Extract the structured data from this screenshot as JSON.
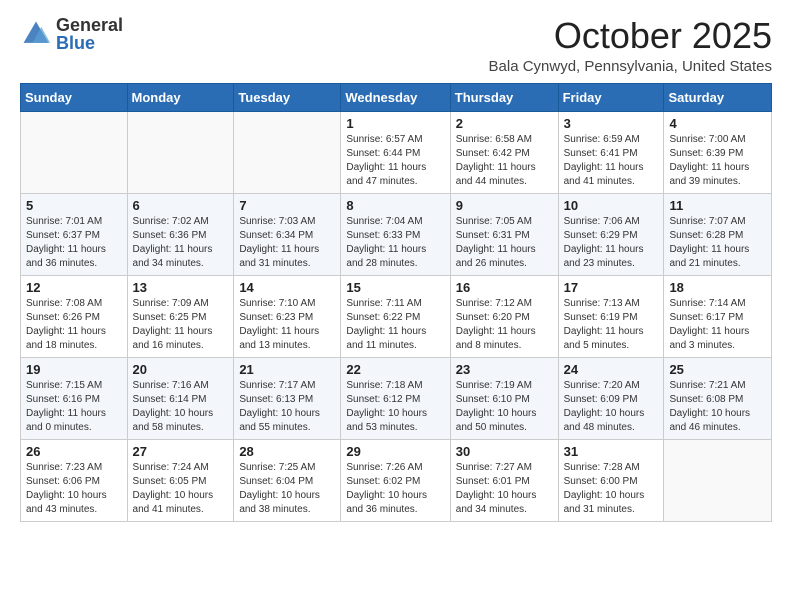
{
  "logo": {
    "general": "General",
    "blue": "Blue"
  },
  "header": {
    "title": "October 2025",
    "location": "Bala Cynwyd, Pennsylvania, United States"
  },
  "days_of_week": [
    "Sunday",
    "Monday",
    "Tuesday",
    "Wednesday",
    "Thursday",
    "Friday",
    "Saturday"
  ],
  "weeks": [
    [
      {
        "day": "",
        "info": ""
      },
      {
        "day": "",
        "info": ""
      },
      {
        "day": "",
        "info": ""
      },
      {
        "day": "1",
        "info": "Sunrise: 6:57 AM\nSunset: 6:44 PM\nDaylight: 11 hours\nand 47 minutes."
      },
      {
        "day": "2",
        "info": "Sunrise: 6:58 AM\nSunset: 6:42 PM\nDaylight: 11 hours\nand 44 minutes."
      },
      {
        "day": "3",
        "info": "Sunrise: 6:59 AM\nSunset: 6:41 PM\nDaylight: 11 hours\nand 41 minutes."
      },
      {
        "day": "4",
        "info": "Sunrise: 7:00 AM\nSunset: 6:39 PM\nDaylight: 11 hours\nand 39 minutes."
      }
    ],
    [
      {
        "day": "5",
        "info": "Sunrise: 7:01 AM\nSunset: 6:37 PM\nDaylight: 11 hours\nand 36 minutes."
      },
      {
        "day": "6",
        "info": "Sunrise: 7:02 AM\nSunset: 6:36 PM\nDaylight: 11 hours\nand 34 minutes."
      },
      {
        "day": "7",
        "info": "Sunrise: 7:03 AM\nSunset: 6:34 PM\nDaylight: 11 hours\nand 31 minutes."
      },
      {
        "day": "8",
        "info": "Sunrise: 7:04 AM\nSunset: 6:33 PM\nDaylight: 11 hours\nand 28 minutes."
      },
      {
        "day": "9",
        "info": "Sunrise: 7:05 AM\nSunset: 6:31 PM\nDaylight: 11 hours\nand 26 minutes."
      },
      {
        "day": "10",
        "info": "Sunrise: 7:06 AM\nSunset: 6:29 PM\nDaylight: 11 hours\nand 23 minutes."
      },
      {
        "day": "11",
        "info": "Sunrise: 7:07 AM\nSunset: 6:28 PM\nDaylight: 11 hours\nand 21 minutes."
      }
    ],
    [
      {
        "day": "12",
        "info": "Sunrise: 7:08 AM\nSunset: 6:26 PM\nDaylight: 11 hours\nand 18 minutes."
      },
      {
        "day": "13",
        "info": "Sunrise: 7:09 AM\nSunset: 6:25 PM\nDaylight: 11 hours\nand 16 minutes."
      },
      {
        "day": "14",
        "info": "Sunrise: 7:10 AM\nSunset: 6:23 PM\nDaylight: 11 hours\nand 13 minutes."
      },
      {
        "day": "15",
        "info": "Sunrise: 7:11 AM\nSunset: 6:22 PM\nDaylight: 11 hours\nand 11 minutes."
      },
      {
        "day": "16",
        "info": "Sunrise: 7:12 AM\nSunset: 6:20 PM\nDaylight: 11 hours\nand 8 minutes."
      },
      {
        "day": "17",
        "info": "Sunrise: 7:13 AM\nSunset: 6:19 PM\nDaylight: 11 hours\nand 5 minutes."
      },
      {
        "day": "18",
        "info": "Sunrise: 7:14 AM\nSunset: 6:17 PM\nDaylight: 11 hours\nand 3 minutes."
      }
    ],
    [
      {
        "day": "19",
        "info": "Sunrise: 7:15 AM\nSunset: 6:16 PM\nDaylight: 11 hours\nand 0 minutes."
      },
      {
        "day": "20",
        "info": "Sunrise: 7:16 AM\nSunset: 6:14 PM\nDaylight: 10 hours\nand 58 minutes."
      },
      {
        "day": "21",
        "info": "Sunrise: 7:17 AM\nSunset: 6:13 PM\nDaylight: 10 hours\nand 55 minutes."
      },
      {
        "day": "22",
        "info": "Sunrise: 7:18 AM\nSunset: 6:12 PM\nDaylight: 10 hours\nand 53 minutes."
      },
      {
        "day": "23",
        "info": "Sunrise: 7:19 AM\nSunset: 6:10 PM\nDaylight: 10 hours\nand 50 minutes."
      },
      {
        "day": "24",
        "info": "Sunrise: 7:20 AM\nSunset: 6:09 PM\nDaylight: 10 hours\nand 48 minutes."
      },
      {
        "day": "25",
        "info": "Sunrise: 7:21 AM\nSunset: 6:08 PM\nDaylight: 10 hours\nand 46 minutes."
      }
    ],
    [
      {
        "day": "26",
        "info": "Sunrise: 7:23 AM\nSunset: 6:06 PM\nDaylight: 10 hours\nand 43 minutes."
      },
      {
        "day": "27",
        "info": "Sunrise: 7:24 AM\nSunset: 6:05 PM\nDaylight: 10 hours\nand 41 minutes."
      },
      {
        "day": "28",
        "info": "Sunrise: 7:25 AM\nSunset: 6:04 PM\nDaylight: 10 hours\nand 38 minutes."
      },
      {
        "day": "29",
        "info": "Sunrise: 7:26 AM\nSunset: 6:02 PM\nDaylight: 10 hours\nand 36 minutes."
      },
      {
        "day": "30",
        "info": "Sunrise: 7:27 AM\nSunset: 6:01 PM\nDaylight: 10 hours\nand 34 minutes."
      },
      {
        "day": "31",
        "info": "Sunrise: 7:28 AM\nSunset: 6:00 PM\nDaylight: 10 hours\nand 31 minutes."
      },
      {
        "day": "",
        "info": ""
      }
    ]
  ]
}
